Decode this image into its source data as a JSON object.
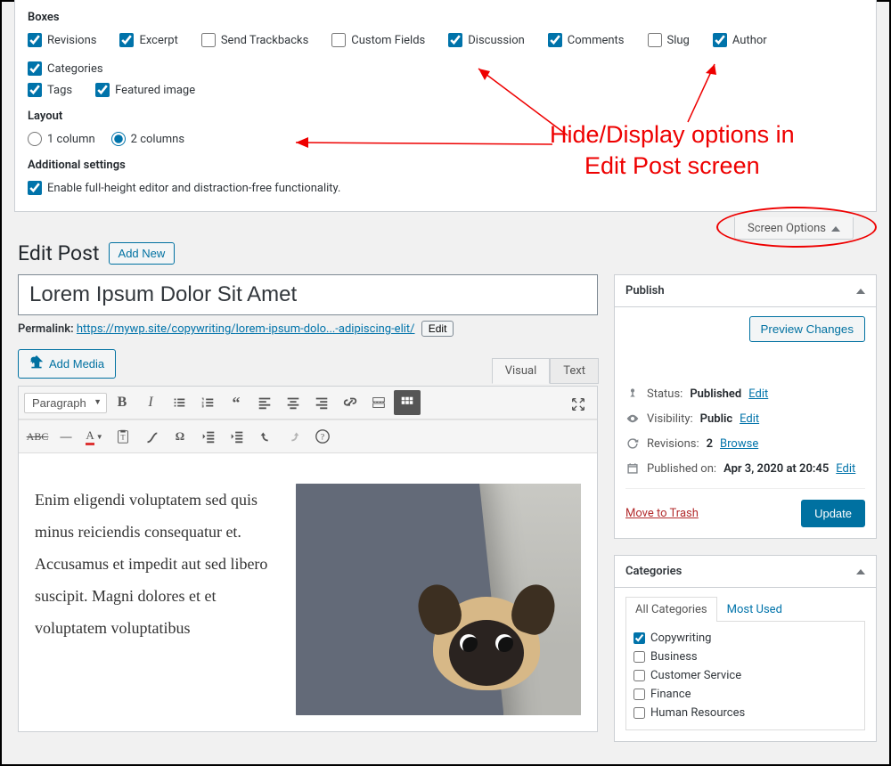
{
  "screen_options": {
    "boxes_title": "Boxes",
    "checkboxes": [
      {
        "label": "Revisions",
        "checked": true
      },
      {
        "label": "Excerpt",
        "checked": true
      },
      {
        "label": "Send Trackbacks",
        "checked": false
      },
      {
        "label": "Custom Fields",
        "checked": false
      },
      {
        "label": "Discussion",
        "checked": true
      },
      {
        "label": "Comments",
        "checked": true
      },
      {
        "label": "Slug",
        "checked": false
      },
      {
        "label": "Author",
        "checked": true
      },
      {
        "label": "Categories",
        "checked": true
      },
      {
        "label": "Tags",
        "checked": true
      },
      {
        "label": "Featured image",
        "checked": true
      }
    ],
    "layout_title": "Layout",
    "layout_options": [
      {
        "label": "1 column",
        "selected": false
      },
      {
        "label": "2 columns",
        "selected": true
      }
    ],
    "additional_title": "Additional settings",
    "additional_checkbox": {
      "label": "Enable full-height editor and distraction-free functionality.",
      "checked": true
    },
    "tab_label": "Screen Options"
  },
  "heading": {
    "title": "Edit Post",
    "add_new": "Add New"
  },
  "post": {
    "title": "Lorem Ipsum Dolor Sit Amet",
    "permalink_label": "Permalink:",
    "permalink_base": "https://mywp.site/copywriting/",
    "permalink_slug": "lorem-ipsum-dolo...-adipiscing-elit/",
    "edit_label": "Edit",
    "add_media": "Add Media",
    "tabs": {
      "visual": "Visual",
      "text": "Text"
    },
    "format_select": "Paragraph",
    "body_text": "Enim eligendi voluptatem sed quis minus reiciendis consequatur et. Accusamus et impedit aut sed libero suscipit. Magni dolores et et voluptatem voluptatibus"
  },
  "publish": {
    "title": "Publish",
    "preview": "Preview Changes",
    "status_label": "Status:",
    "status_value": "Published",
    "status_edit": "Edit",
    "visibility_label": "Visibility:",
    "visibility_value": "Public",
    "visibility_edit": "Edit",
    "revisions_label": "Revisions:",
    "revisions_value": "2",
    "revisions_browse": "Browse",
    "published_label": "Published on:",
    "published_value": "Apr 3, 2020 at 20:45",
    "published_edit": "Edit",
    "trash": "Move to Trash",
    "update": "Update"
  },
  "categories": {
    "title": "Categories",
    "tab_all": "All Categories",
    "tab_most": "Most Used",
    "items": [
      {
        "label": "Copywriting",
        "checked": true
      },
      {
        "label": "Business",
        "checked": false
      },
      {
        "label": "Customer Service",
        "checked": false
      },
      {
        "label": "Finance",
        "checked": false
      },
      {
        "label": "Human Resources",
        "checked": false
      }
    ]
  },
  "annotation": {
    "line1": "Hide/Display options in",
    "line2": "Edit Post screen"
  }
}
